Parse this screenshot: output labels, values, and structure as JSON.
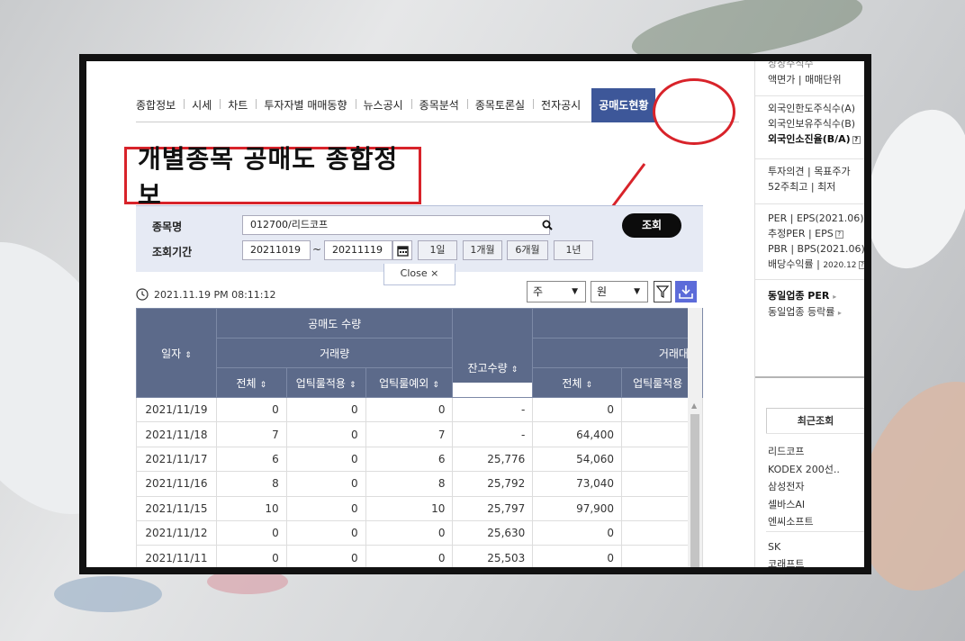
{
  "nav": {
    "items": [
      "종합정보",
      "시세",
      "차트",
      "투자자별 매매동향",
      "뉴스공시",
      "종목분석",
      "종목토론실",
      "전자공시"
    ],
    "active": "공매도현황"
  },
  "title": "개별종목 공매도 종합정보",
  "search": {
    "stock_label": "종목명",
    "stock_value": "012700/리드코프",
    "period_label": "조회기간",
    "date_from": "20211019",
    "tilde": "~",
    "date_to": "20211119",
    "periods": [
      "1일",
      "1개월",
      "6개월",
      "1년"
    ],
    "query_button": "조회",
    "close_label": "Close ×"
  },
  "timestamp": "2021.11.19 PM 08:11:12",
  "controls": {
    "unit_select": "주",
    "currency_select": "원"
  },
  "table": {
    "headers": {
      "date": "일자",
      "short_volume": "공매도 수량",
      "trade_volume": "거래량",
      "balance": "잔고수량",
      "trade_amount": "거래대금",
      "total": "전체",
      "uptick_applied": "업틱룰적용",
      "uptick_exempt": "업틱룰예외",
      "total2": "전체",
      "uptick_applied2": "업틱룰적용"
    },
    "rows": [
      [
        "2021/11/19",
        "0",
        "0",
        "0",
        "-",
        "0",
        ""
      ],
      [
        "2021/11/18",
        "7",
        "0",
        "7",
        "-",
        "64,400",
        ""
      ],
      [
        "2021/11/17",
        "6",
        "0",
        "6",
        "25,776",
        "54,060",
        ""
      ],
      [
        "2021/11/16",
        "8",
        "0",
        "8",
        "25,792",
        "73,040",
        ""
      ],
      [
        "2021/11/15",
        "10",
        "0",
        "10",
        "25,797",
        "97,900",
        ""
      ],
      [
        "2021/11/12",
        "0",
        "0",
        "0",
        "25,630",
        "0",
        ""
      ],
      [
        "2021/11/11",
        "0",
        "0",
        "0",
        "25,503",
        "0",
        ""
      ]
    ]
  },
  "sidebar": {
    "cut_top": "상장주식수",
    "face": "액면가",
    "trade_unit": "매매단위",
    "foreign_a": "외국인한도주식수(A)",
    "foreign_b": "외국인보유주식수(B)",
    "foreign_ratio": "외국인소진율(B/A)",
    "opinion": "투자의견",
    "target": "목표주가",
    "week52_high": "52주최고",
    "week52_low": "최저",
    "per": "PER",
    "eps": "EPS(2021.06)",
    "est_per": "추정PER",
    "est_eps": "EPS",
    "pbr": "PBR",
    "bps": "BPS(2021.06)",
    "div": "배당수익률",
    "div_date": "2020.12",
    "sector_per": "동일업종 PER",
    "sector_rate": "동일업종 등락률",
    "recent_title": "최근조회",
    "recent": [
      "리드코프",
      "KODEX 200선..",
      "삼성전자",
      "셀바스AI",
      "엔씨소프트"
    ],
    "recent2": [
      "SK",
      "코래프트"
    ]
  }
}
